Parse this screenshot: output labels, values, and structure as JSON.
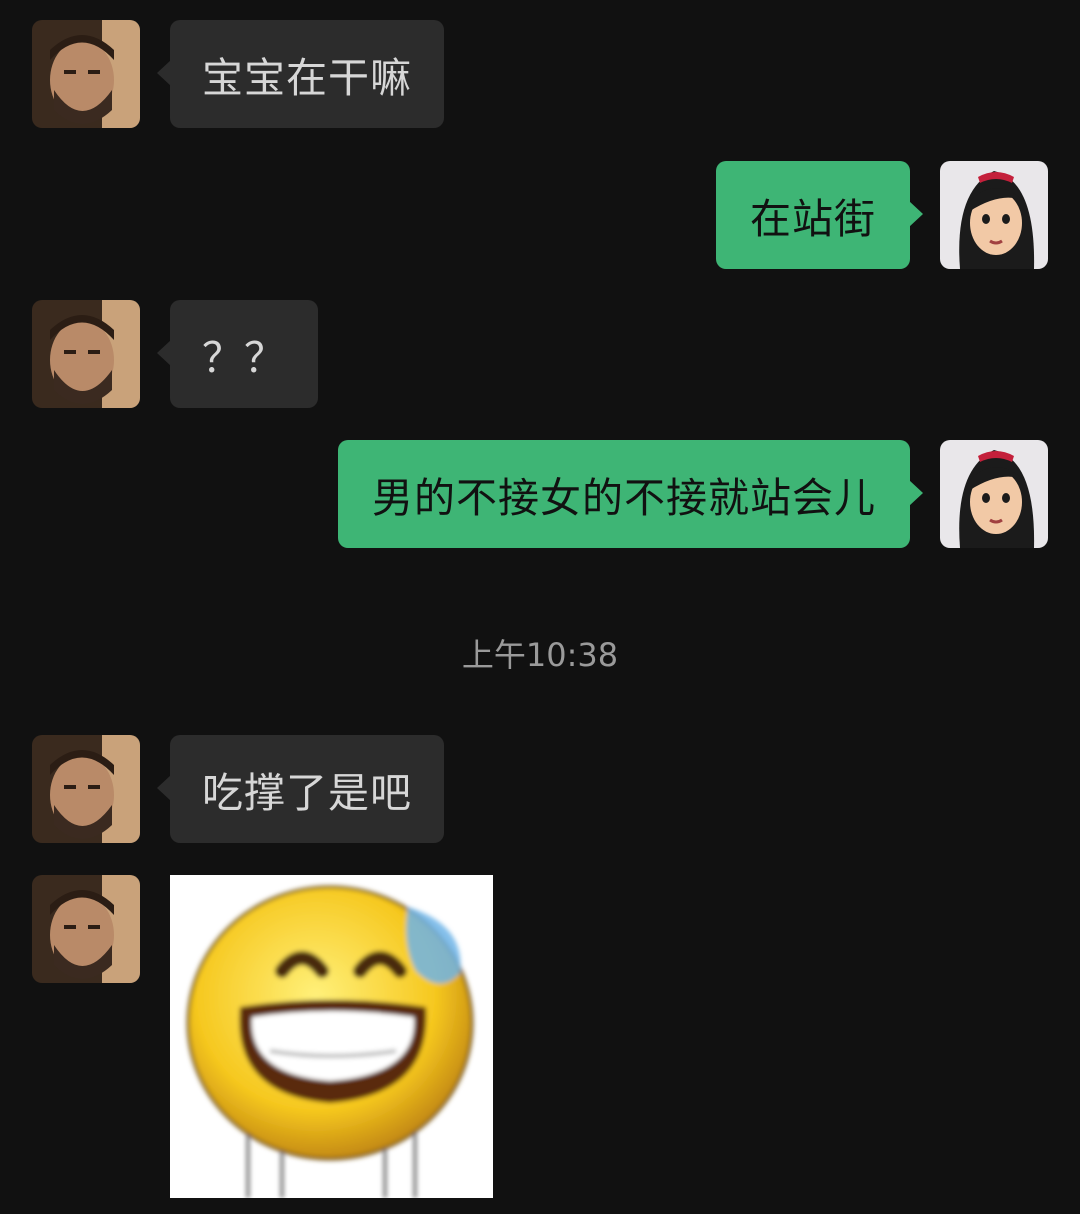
{
  "app": "chat",
  "colors": {
    "background": "#111111",
    "incoming_bubble": "#2c2c2c",
    "outgoing_bubble": "#3eb575",
    "timestamp_text": "#9a9a9a"
  },
  "contacts": {
    "other": {
      "avatar_icon": "bearded-man-avatar"
    },
    "self": {
      "avatar_icon": "cartoon-girl-avatar"
    }
  },
  "messages": [
    {
      "from": "other",
      "type": "text",
      "text": "宝宝在干嘛"
    },
    {
      "from": "self",
      "type": "text",
      "text": "在站街"
    },
    {
      "from": "other",
      "type": "text",
      "text": "？？"
    },
    {
      "from": "self",
      "type": "text",
      "text": "男的不接女的不接就站会儿"
    },
    {
      "type": "timestamp",
      "text": "上午10:38"
    },
    {
      "from": "other",
      "type": "text",
      "text": "吃撑了是吧"
    },
    {
      "from": "other",
      "type": "sticker",
      "sticker_icon": "grinning-sweat-emoji"
    }
  ]
}
